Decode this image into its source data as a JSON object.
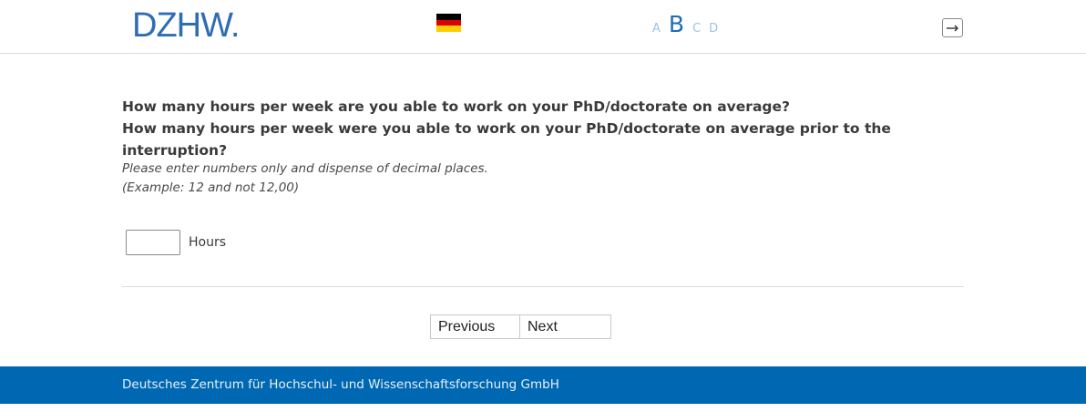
{
  "header": {
    "logo_text": "DZHW.",
    "language_flag": "germany-flag",
    "font_size_options": [
      "A",
      "B",
      "C",
      "D"
    ],
    "font_size_active": "B",
    "logout_icon": "exit-icon"
  },
  "question": {
    "line1": "How many hours per week are you able to work on your PhD/doctorate on average?",
    "line2": "How many hours per week were you able to work on your PhD/doctorate on average prior to the interruption?",
    "hint_line1": "Please enter numbers only and dispense of decimal places.",
    "hint_line2": "(Example: 12 and not 12,00)"
  },
  "answer": {
    "value": "",
    "unit": "Hours"
  },
  "navigation": {
    "previous_label": "Previous",
    "next_label": "Next"
  },
  "footer": {
    "text": "Deutsches Zentrum für Hochschul- und Wissenschaftsforschung GmbH"
  },
  "colors": {
    "brand_blue": "#0068b3",
    "logo_blue": "#2f6db3",
    "font_option_inactive": "#9cc3e6"
  }
}
